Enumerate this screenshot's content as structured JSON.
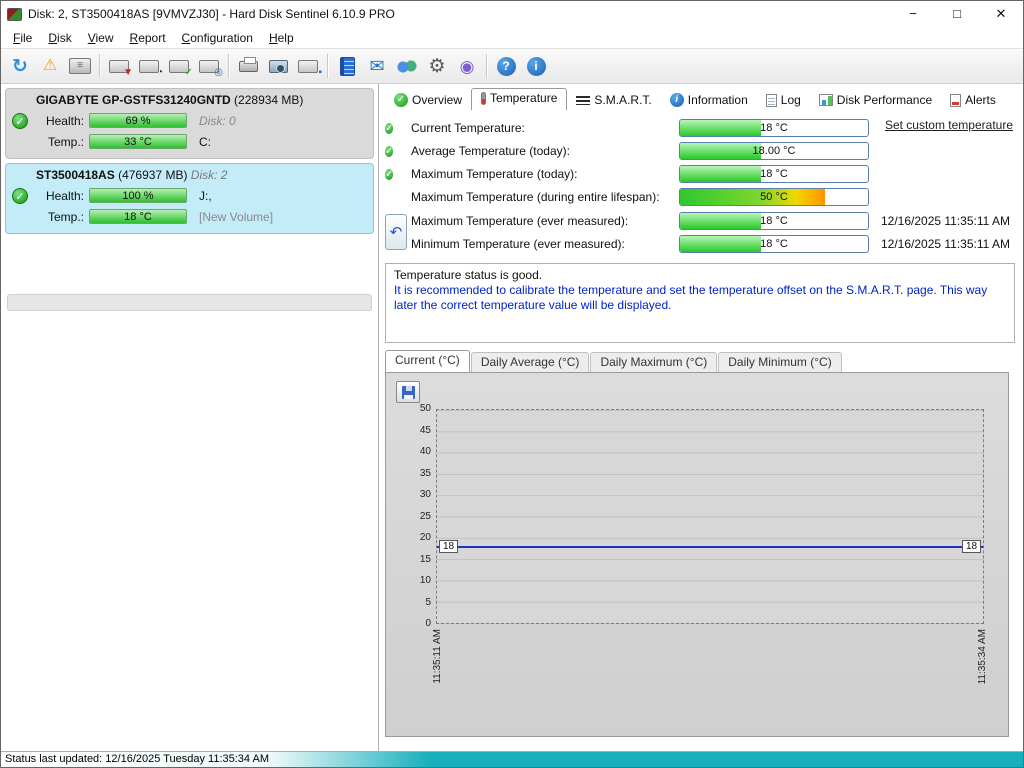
{
  "icons": {
    "check": "✓",
    "warning": "⚠",
    "refresh": "↻",
    "undo": "↶",
    "mail": "✉",
    "gear": "⚙",
    "orb": "◉",
    "question": "?",
    "info": "i",
    "lines": "≡",
    "down": "▼",
    "clock": "◔",
    "search": "◎",
    "square": "▪"
  },
  "window": {
    "title": "Disk: 2, ST3500418AS [9VMVZJ30]  -  Hard Disk Sentinel 6.10.9 PRO",
    "controls": {
      "min": "−",
      "max": "□",
      "close": "✕"
    }
  },
  "menu": {
    "items": [
      "File",
      "Disk",
      "View",
      "Report",
      "Configuration",
      "Help"
    ]
  },
  "sidebar": {
    "disks": [
      {
        "name": "GIGABYTE GP-GSTFS31240GNTD",
        "size": " (228934 MB)",
        "disk_label": "",
        "health_label": "Health:",
        "health_value": "69 %",
        "health_extra": "Disk: 0",
        "temp_label": "Temp.:",
        "temp_value": "33 °C",
        "temp_extra": "C:"
      },
      {
        "name": "ST3500418AS",
        "size": " (476937 MB) ",
        "disk_label": "Disk: 2",
        "health_label": "Health:",
        "health_value": "100 %",
        "health_extra": "J:,",
        "temp_label": "Temp.:",
        "temp_value": "18 °C",
        "temp_extra": "[New Volume]"
      }
    ]
  },
  "tabs": {
    "items": [
      {
        "label": "Overview"
      },
      {
        "label": "Temperature"
      },
      {
        "label": "S.M.A.R.T."
      },
      {
        "label": "Information"
      },
      {
        "label": "Log"
      },
      {
        "label": "Disk Performance"
      },
      {
        "label": "Alerts"
      }
    ]
  },
  "temperature": {
    "rows": [
      {
        "label": "Current Temperature:",
        "value": "18 °C",
        "fill": 43
      },
      {
        "label": "Average Temperature (today):",
        "value": "18.00 °C",
        "fill": 43
      },
      {
        "label": "Maximum Temperature (today):",
        "value": "18 °C",
        "fill": 43
      },
      {
        "label": "Maximum Temperature (during entire lifespan):",
        "value": "50 °C",
        "fill": 77
      },
      {
        "label": "Maximum Temperature (ever measured):",
        "value": "18 °C",
        "fill": 43,
        "date": "12/16/2025 11:35:11 AM"
      },
      {
        "label": "Minimum Temperature (ever measured):",
        "value": "18 °C",
        "fill": 43,
        "date": "12/16/2025 11:35:11 AM"
      }
    ],
    "set_custom_link": "Set custom temperature",
    "note_line1": "Temperature status is good.",
    "note_line2": "It is recommended to calibrate the temperature and set the temperature offset on the S.M.A.R.T. page. This way later the correct temperature value will be displayed."
  },
  "chart_tabs": {
    "items": [
      "Current (°C)",
      "Daily Average (°C)",
      "Daily Maximum (°C)",
      "Daily Minimum (°C)"
    ]
  },
  "chart_data": {
    "type": "line",
    "title": "Current (°C)",
    "x": [
      "11:35:11 AM",
      "11:35:34 AM"
    ],
    "values": [
      18,
      18
    ],
    "ylim": [
      0,
      50
    ],
    "yticks": [
      50,
      45,
      40,
      35,
      30,
      25,
      20,
      15,
      10,
      5,
      0
    ],
    "line_color": "#2233bb",
    "line_top_pct": 64,
    "grid": true,
    "legend": false
  },
  "statusbar": {
    "text": "Status last updated: 12/16/2025 Tuesday 11:35:34 AM"
  }
}
